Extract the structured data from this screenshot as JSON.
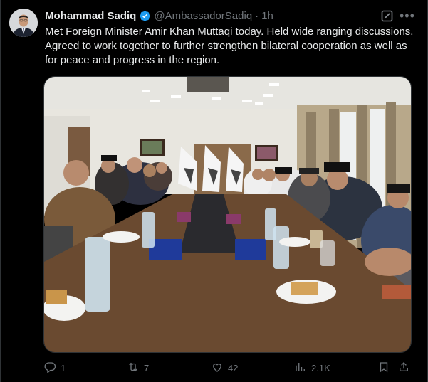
{
  "tweet": {
    "author_name": "Mohammad Sadiq",
    "handle": "@AmbassadorSadiq",
    "separator": "·",
    "time": "1h",
    "text": "Met Foreign Minister Amir Khan Muttaqi today. Held wide ranging discussions. Agreed to work together to further strengthen bilateral cooperation as well as for peace and progress in the region.",
    "verified_color": "#1d9bf0"
  },
  "stats": {
    "replies": "1",
    "reposts": "7",
    "likes": "42",
    "views": "2.1K"
  },
  "icons": [
    "verified-icon",
    "grok-icon",
    "more-icon",
    "reply-icon",
    "repost-icon",
    "like-icon",
    "views-icon",
    "bookmark-icon",
    "share-icon"
  ]
}
